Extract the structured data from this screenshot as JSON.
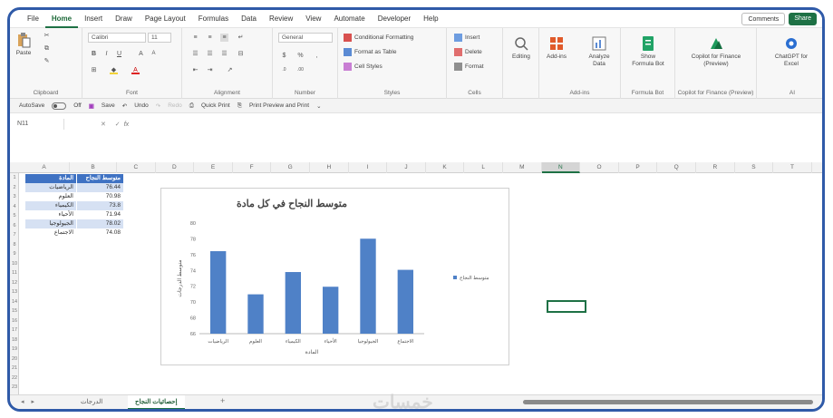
{
  "menu": {
    "tabs": [
      "File",
      "Home",
      "Insert",
      "Draw",
      "Page Layout",
      "Formulas",
      "Data",
      "Review",
      "View",
      "Automate",
      "Developer",
      "Help"
    ],
    "active_tab": "Home",
    "comments_label": "Comments",
    "share_label": "Share"
  },
  "ribbon": {
    "clipboard": {
      "paste": "Paste",
      "label": "Clipboard"
    },
    "font": {
      "name": "Calibri",
      "size": "11",
      "label": "Font"
    },
    "alignment": {
      "label": "Alignment"
    },
    "number": {
      "format": "General",
      "label": "Number"
    },
    "styles": {
      "conditional": "Conditional Formatting",
      "format_table": "Format as Table",
      "cell_styles": "Cell Styles",
      "label": "Styles"
    },
    "cells": {
      "insert": "Insert",
      "delete": "Delete",
      "format": "Format",
      "label": "Cells"
    },
    "editing": {
      "label": "Editing"
    },
    "addins": {
      "label": "Add-ins",
      "addins_btn": "Add-ins",
      "analyze": "Analyze Data"
    },
    "formula_bot": {
      "btn": "Show Formula Bot",
      "label": "Formula Bot"
    },
    "copilot": {
      "btn": "Copilot for Finance (Preview)",
      "label": "Copilot for Finance (Preview)"
    },
    "chatgpt": {
      "btn": "ChatGPT for Excel",
      "label": "AI"
    }
  },
  "qat": {
    "autosave": "AutoSave",
    "autosave_state": "Off",
    "save": "Save",
    "undo": "Undo",
    "redo": "Redo",
    "quick_print": "Quick Print",
    "print_preview": "Print Preview and Print"
  },
  "formula_bar": {
    "name_box": "N11",
    "fx": "fx"
  },
  "columns": [
    "A",
    "B",
    "C",
    "D",
    "E",
    "F",
    "G",
    "H",
    "I",
    "J",
    "K",
    "L",
    "M",
    "N",
    "O",
    "P",
    "Q",
    "R",
    "S",
    "T"
  ],
  "selected_column": "N",
  "rows": [
    "1",
    "2",
    "3",
    "4",
    "5",
    "6",
    "7",
    "8",
    "9",
    "10",
    "11",
    "12",
    "13",
    "14",
    "15",
    "16",
    "17",
    "18",
    "19",
    "20",
    "21",
    "22",
    "23"
  ],
  "table": {
    "headers": [
      "المادة",
      "متوسط النجاح"
    ],
    "rows": [
      [
        "الرياضيات",
        "76.44"
      ],
      [
        "العلوم",
        "70.98"
      ],
      [
        "الكيمياء",
        "73.8"
      ],
      [
        "الأحياء",
        "71.94"
      ],
      [
        "الجيولوجيا",
        "78.02"
      ],
      [
        "الاجتماع",
        "74.08"
      ]
    ]
  },
  "chart_data": {
    "type": "bar",
    "title": "متوسط النجاح في كل مادة",
    "categories": [
      "الرياضيات",
      "العلوم",
      "الكيمياء",
      "الأحياء",
      "الجيولوجيا",
      "الاجتماع"
    ],
    "series": [
      {
        "name": "متوسط النجاح",
        "values": [
          76.44,
          70.98,
          73.8,
          71.94,
          78.02,
          74.08
        ],
        "color": "#4f81c7"
      }
    ],
    "xlabel": "المادة",
    "ylabel": "متوسط الدرجات",
    "ylim": [
      66,
      80
    ],
    "yticks": [
      "66",
      "68",
      "70",
      "72",
      "74",
      "76",
      "78",
      "80"
    ],
    "grid": false,
    "legend": "right"
  },
  "sheets": {
    "tabs": [
      "الدرجات",
      "إحصائيات النجاح"
    ],
    "active": "إحصائيات النجاح",
    "add": "+"
  },
  "watermark": "خمسات",
  "colors": {
    "accent": "#1e7145",
    "frame": "#2f5aa8",
    "table_header": "#3f72c3",
    "table_band": "#d6e1f3",
    "bar": "#4f81c7"
  }
}
